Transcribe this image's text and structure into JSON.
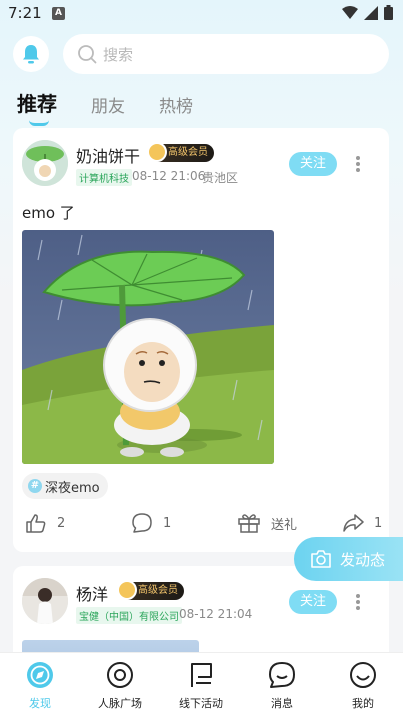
{
  "status_bar": {
    "time": "7:21",
    "notice": "A"
  },
  "search": {
    "placeholder": "搜索"
  },
  "tabs": [
    {
      "label": "推荐",
      "active": true
    },
    {
      "label": "朋友",
      "active": false
    },
    {
      "label": "热榜",
      "active": false
    }
  ],
  "posts": [
    {
      "username": "奶油饼干",
      "vip_label": "高级会员",
      "company_tag": "计算机科技",
      "time": "08-12 21:06",
      "location": "贵池区",
      "follow_label": "关注",
      "text": "emo 了",
      "topic": "深夜emo",
      "likes": "2",
      "comments": "1",
      "gift_label": "送礼",
      "shares": "1"
    },
    {
      "username": "杨洋",
      "vip_label": "高级会员",
      "company_tag": "宝健（中国）有限公司",
      "time": "08-12 21:04",
      "follow_label": "关注"
    }
  ],
  "fab": {
    "label": "发动态"
  },
  "bottom_nav": [
    {
      "label": "发现",
      "icon": "discover-icon",
      "active": true
    },
    {
      "label": "人脉广场",
      "icon": "network-plaza-icon",
      "active": false
    },
    {
      "label": "线下活动",
      "icon": "flag-icon",
      "active": false
    },
    {
      "label": "消息",
      "icon": "message-icon",
      "active": false
    },
    {
      "label": "我的",
      "icon": "smile-profile-icon",
      "active": false
    }
  ],
  "colors": {
    "accent": "#4fc9ea",
    "follow": "#7fdcf4",
    "tag_green": "#2aa55a"
  }
}
